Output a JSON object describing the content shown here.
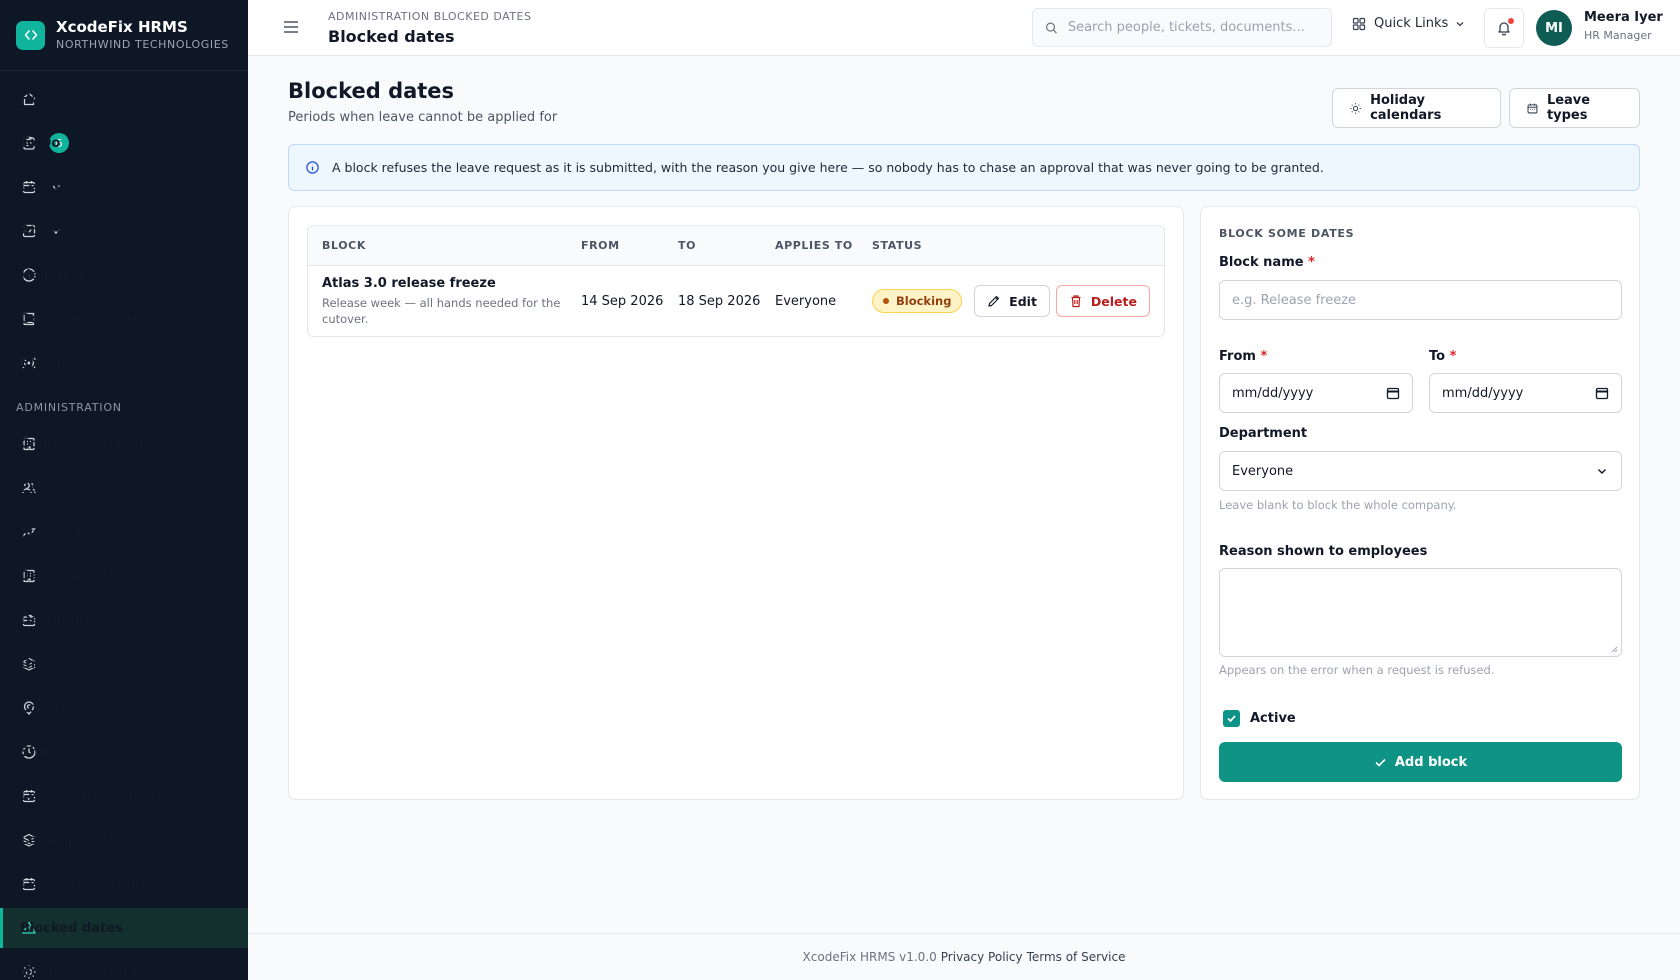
{
  "brand": {
    "name": "XcodeFix HRMS",
    "org": "NORTHWIND TECHNOLOGIES",
    "color": "#10b39b"
  },
  "sidebar": {
    "items": [
      {
        "label": "Home",
        "icon": "home-icon"
      },
      {
        "label": "To Do",
        "icon": "clipboard-icon",
        "badge": "6"
      },
      {
        "label": "Leave",
        "icon": "calendar-icon",
        "expandable": true
      },
      {
        "label": "Attendance",
        "icon": "check-square-icon",
        "expandable": true
      },
      {
        "label": "Helpdesk",
        "icon": "info-circle-icon"
      },
      {
        "label": "Document Center",
        "icon": "book-icon"
      },
      {
        "label": "Engage",
        "icon": "broadcast-icon"
      }
    ],
    "section_label": "ADMINISTRATION",
    "admin_items": [
      {
        "label": "Company settings",
        "icon": "building-icon"
      },
      {
        "label": "Employees",
        "icon": "users-icon"
      },
      {
        "label": "Movements",
        "icon": "trend-icon"
      },
      {
        "label": "Departments",
        "icon": "building-icon"
      },
      {
        "label": "Designations",
        "icon": "briefcase-icon"
      },
      {
        "label": "Grades",
        "icon": "layers-icon"
      },
      {
        "label": "Locations",
        "icon": "map-pin-icon"
      },
      {
        "label": "Shifts",
        "icon": "clock-icon"
      },
      {
        "label": "Leave types & policies",
        "icon": "calendar-check-icon"
      },
      {
        "label": "Leave policies",
        "icon": "layers-icon"
      },
      {
        "label": "Leave allocations",
        "icon": "calendar-icon"
      },
      {
        "label": "Blocked dates",
        "icon": "warning-icon",
        "active": true
      },
      {
        "label": "Holiday calendars",
        "icon": "sun-icon"
      }
    ]
  },
  "topbar": {
    "breadcrumb": "ADMINISTRATION BLOCKED DATES",
    "title": "Blocked dates",
    "search_placeholder": "Search people, tickets, documents...",
    "quick_links": "Quick Links",
    "user": {
      "initials": "MI",
      "name": "Meera Iyer",
      "role": "HR Manager"
    }
  },
  "page": {
    "title": "Blocked dates",
    "subtitle": "Periods when leave cannot be applied for",
    "buttons": {
      "holiday_calendars": "Holiday calendars",
      "leave_types": "Leave types"
    },
    "info": "A block refuses the leave request as it is submitted, with the reason you give here — so nobody has to chase an approval that was never going to be granted."
  },
  "table": {
    "columns": [
      "BLOCK",
      "FROM",
      "TO",
      "APPLIES TO",
      "STATUS"
    ],
    "rows": [
      {
        "name": "Atlas 3.0 release freeze",
        "description": "Release week — all hands needed for the cutover.",
        "from": "14 Sep 2026",
        "to": "18 Sep 2026",
        "applies_to": "Everyone",
        "status": "Blocking",
        "edit_label": "Edit",
        "delete_label": "Delete"
      }
    ]
  },
  "form": {
    "title": "BLOCK SOME DATES",
    "name_label": "Block name",
    "name_placeholder": "e.g. Release freeze",
    "required_mark": "*",
    "from_label": "From",
    "to_label": "To",
    "date_placeholder": "mm/dd/yyyy",
    "department_label": "Department",
    "department_value": "Everyone",
    "department_hint": "Leave blank to block the whole company.",
    "reason_label": "Reason shown to employees",
    "reason_hint": "Appears on the error when a request is refused.",
    "active_label": "Active",
    "active_checked": true,
    "submit_label": "Add block"
  },
  "footer": {
    "version": "XcodeFix HRMS v1.0.0",
    "privacy": "Privacy Policy",
    "terms": "Terms of Service"
  }
}
